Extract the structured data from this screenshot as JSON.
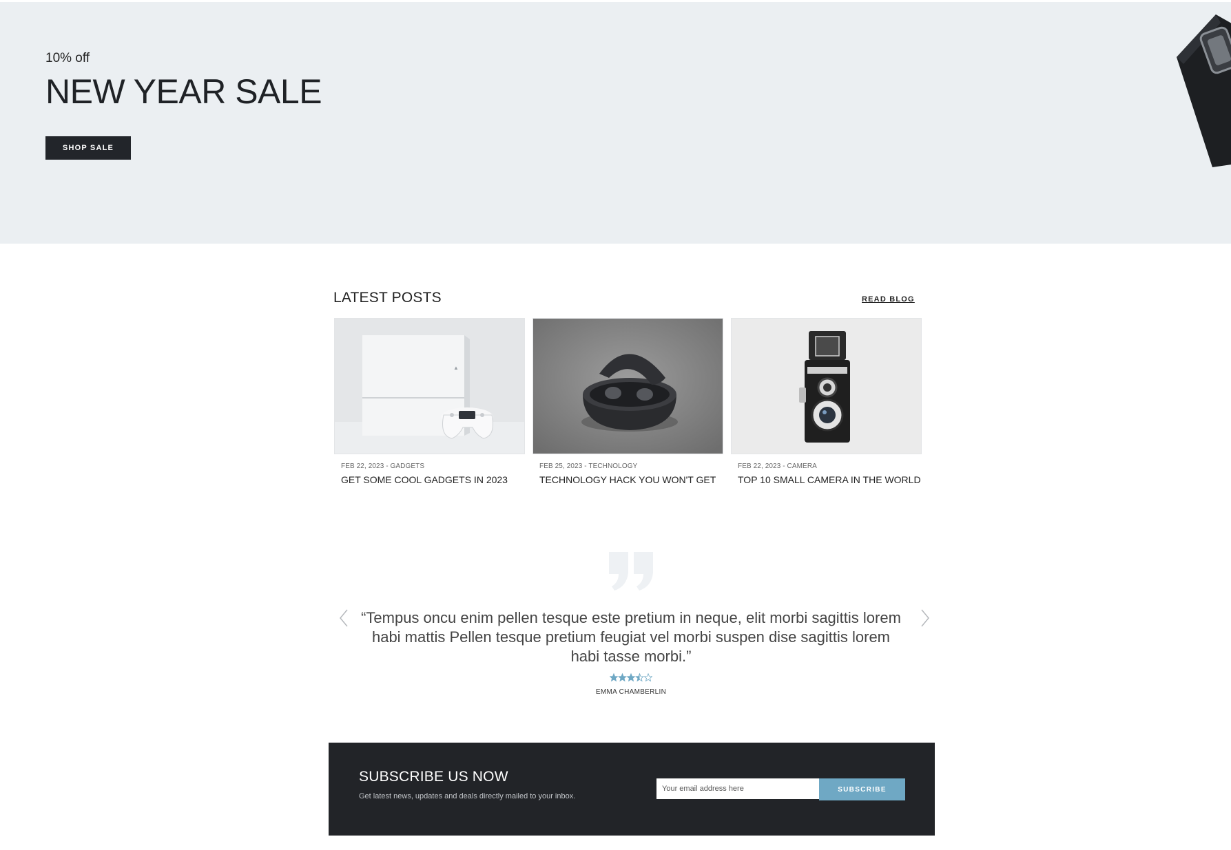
{
  "hero": {
    "eyebrow": "10% off",
    "title": "NEW YEAR SALE",
    "button_label": "SHOP SALE",
    "background_color": "#ebeff2"
  },
  "latest_posts": {
    "title": "LATEST POSTS",
    "read_blog_label": "READ BLOG",
    "posts": [
      {
        "meta": "FEB 22, 2023 - GADGETS",
        "title": "GET SOME COOL GADGETS IN 2023",
        "image": "game-console-and-controller"
      },
      {
        "meta": "FEB 25, 2023 - TECHNOLOGY",
        "title": "TECHNOLOGY HACK YOU WON'T GET",
        "image": "wireless-earbuds-case"
      },
      {
        "meta": "FEB 22, 2023 - CAMERA",
        "title": "TOP 10 SMALL CAMERA IN THE WORLD",
        "image": "twin-lens-camera"
      }
    ]
  },
  "testimonial": {
    "quote": "“Tempus oncu enim pellen tesque este pretium in neque, elit morbi sagittis lorem habi mattis Pellen tesque pretium feugiat vel morbi suspen dise sagittis lorem habi tasse morbi.”",
    "rating": 3.5,
    "rating_max": 5,
    "author": "EMMA CHAMBERLIN",
    "prev_icon": "chevron-left-icon",
    "next_icon": "chevron-right-icon",
    "star_color": "#6fa8c4"
  },
  "subscribe": {
    "title": "SUBSCRIBE US NOW",
    "description": "Get latest news, updates and deals directly mailed to your inbox.",
    "placeholder": "Your email address here",
    "button_label": "SUBSCRIBE",
    "background_color": "#222428",
    "accent_color": "#6fa8c4"
  }
}
